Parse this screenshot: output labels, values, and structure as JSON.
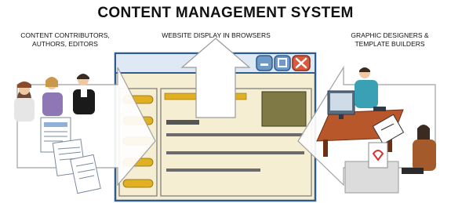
{
  "diagram": {
    "title": "CONTENT MANAGEMENT SYSTEM",
    "labels": {
      "contributors": [
        "CONTENT CONTRIBUTORS,",
        "AUTHORS, EDITORS"
      ],
      "display": "WEBSITE DISPLAY IN BROWSERS",
      "designers": [
        "GRAPHIC DESIGNERS &",
        "TEMPLATE BUILDERS"
      ]
    }
  },
  "colors": {
    "window_fill": "#f5eed2",
    "window_border": "#2f5b8f",
    "titlebar": "#dfe9f5",
    "sidebar_button": "#e0b020",
    "image_block": "#7f7a45",
    "close_button": "#d95a3c",
    "window_button": "#6f9ac8",
    "text_line": "#6b6b6b",
    "arrow_fill": "#ffffff",
    "arrow_stroke": "#9a9a9a"
  },
  "icons": [
    "minimize-icon",
    "maximize-icon",
    "close-icon",
    "document-icon",
    "monitor-icon",
    "tablet-icon"
  ]
}
